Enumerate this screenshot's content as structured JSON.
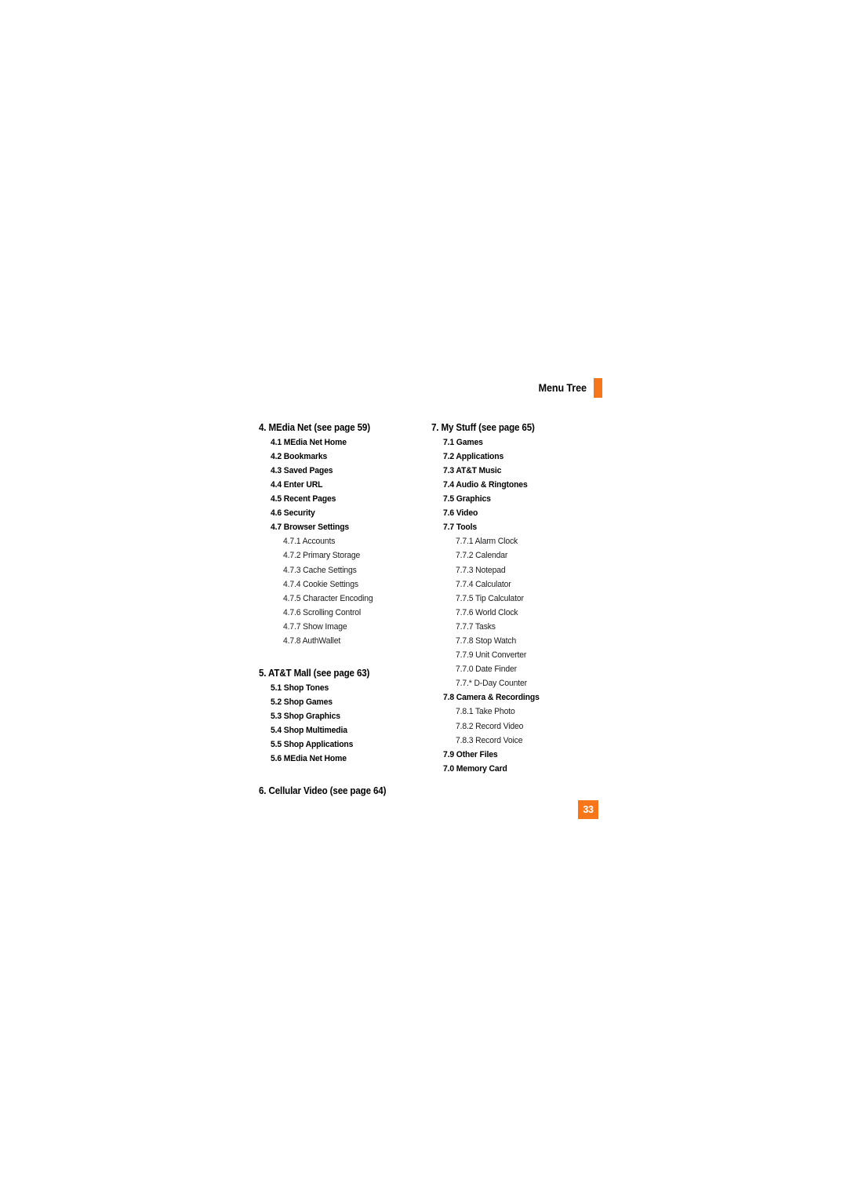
{
  "page": {
    "header_title": "Menu Tree",
    "folio": "33",
    "accent_color": "#F7761C"
  },
  "tree": {
    "columns": [
      {
        "name": "left-column",
        "sections": [
          {
            "title": "4. MEdia Net (see page 59)",
            "items": [
              {
                "label": "4.1 MEdia Net Home",
                "level": 2
              },
              {
                "label": "4.2 Bookmarks",
                "level": 2
              },
              {
                "label": "4.3 Saved Pages",
                "level": 2
              },
              {
                "label": "4.4 Enter URL",
                "level": 2
              },
              {
                "label": "4.5 Recent Pages",
                "level": 2
              },
              {
                "label": "4.6 Security",
                "level": 2
              },
              {
                "label": "4.7 Browser Settings",
                "level": 2
              },
              {
                "label": "4.7.1 Accounts",
                "level": 3
              },
              {
                "label": "4.7.2 Primary Storage",
                "level": 3
              },
              {
                "label": "4.7.3 Cache Settings",
                "level": 3
              },
              {
                "label": "4.7.4 Cookie Settings",
                "level": 3
              },
              {
                "label": "4.7.5 Character Encoding",
                "level": 3
              },
              {
                "label": "4.7.6 Scrolling Control",
                "level": 3
              },
              {
                "label": "4.7.7 Show Image",
                "level": 3
              },
              {
                "label": "4.7.8 AuthWallet",
                "level": 3
              }
            ]
          },
          {
            "title": "5. AT&T Mall (see page 63)",
            "items": [
              {
                "label": "5.1 Shop Tones",
                "level": 2
              },
              {
                "label": "5.2 Shop Games",
                "level": 2
              },
              {
                "label": "5.3 Shop Graphics",
                "level": 2
              },
              {
                "label": "5.4 Shop Multimedia",
                "level": 2
              },
              {
                "label": "5.5 Shop Applications",
                "level": 2
              },
              {
                "label": "5.6 MEdia Net Home",
                "level": 2
              }
            ]
          },
          {
            "title": "6. Cellular Video (see page 64)",
            "items": []
          }
        ]
      },
      {
        "name": "right-column",
        "sections": [
          {
            "title": "7. My Stuff (see page 65)",
            "items": [
              {
                "label": "7.1 Games",
                "level": 2
              },
              {
                "label": "7.2 Applications",
                "level": 2
              },
              {
                "label": "7.3 AT&T Music",
                "level": 2
              },
              {
                "label": "7.4 Audio & Ringtones",
                "level": 2
              },
              {
                "label": "7.5 Graphics",
                "level": 2
              },
              {
                "label": "7.6 Video",
                "level": 2
              },
              {
                "label": "7.7 Tools",
                "level": 2
              },
              {
                "label": "7.7.1 Alarm Clock",
                "level": 3
              },
              {
                "label": "7.7.2 Calendar",
                "level": 3
              },
              {
                "label": "7.7.3 Notepad",
                "level": 3
              },
              {
                "label": "7.7.4 Calculator",
                "level": 3
              },
              {
                "label": "7.7.5 Tip Calculator",
                "level": 3
              },
              {
                "label": "7.7.6 World Clock",
                "level": 3
              },
              {
                "label": "7.7.7 Tasks",
                "level": 3
              },
              {
                "label": "7.7.8 Stop Watch",
                "level": 3
              },
              {
                "label": "7.7.9 Unit Converter",
                "level": 3
              },
              {
                "label": "7.7.0 Date Finder",
                "level": 3
              },
              {
                "label": "7.7.* D-Day Counter",
                "level": 3
              },
              {
                "label": "7.8 Camera & Recordings",
                "level": 2
              },
              {
                "label": "7.8.1 Take Photo",
                "level": 3
              },
              {
                "label": "7.8.2 Record Video",
                "level": 3
              },
              {
                "label": "7.8.3 Record Voice",
                "level": 3
              },
              {
                "label": "7.9 Other Files",
                "level": 2
              },
              {
                "label": "7.0 Memory Card",
                "level": 2
              }
            ]
          }
        ]
      }
    ]
  }
}
